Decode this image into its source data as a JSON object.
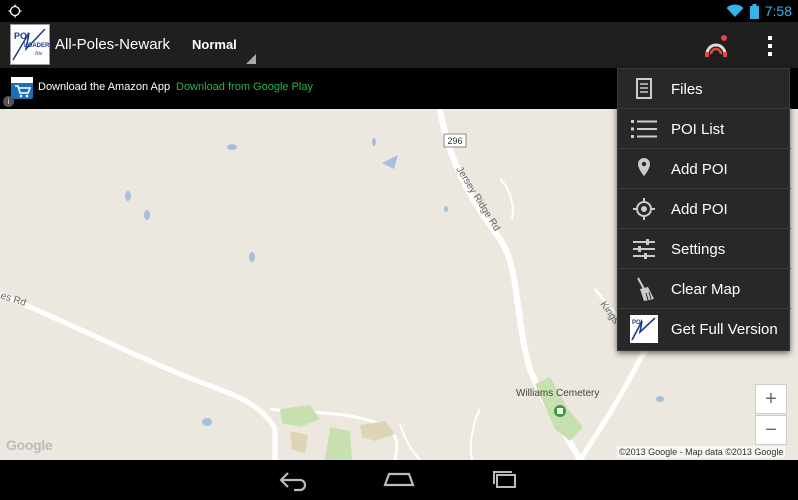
{
  "status_bar": {
    "time": "7:58",
    "icons": [
      "debug-icon",
      "wifi-icon",
      "battery-icon"
    ]
  },
  "action_bar": {
    "app_title": "All-Poles-Newark",
    "mode_value": "Normal",
    "logo_text": "POI LOADER lite",
    "icons": [
      "signal-tracking-icon",
      "overflow-menu-icon"
    ]
  },
  "ad_banner": {
    "text": "Download the Amazon App",
    "link": "Download from Google Play",
    "info": "i"
  },
  "map": {
    "route_shield": "296",
    "road_labels": {
      "jersey_ridge": "Jersey Ridge Rd",
      "es_rd": "es Rd",
      "kings": "Kings"
    },
    "poi_label": "Williams Cemetery",
    "google_logo": "Google",
    "attribution": "©2013 Google - Map data ©2013 Google",
    "zoom_in": "+",
    "zoom_out": "−"
  },
  "overflow_menu": {
    "items": [
      {
        "label": "Files",
        "icon": "file-list-icon"
      },
      {
        "label": "POI List",
        "icon": "poi-list-icon"
      },
      {
        "label": "Add POI",
        "icon": "map-pin-icon"
      },
      {
        "label": "Add POI",
        "icon": "gps-target-icon"
      },
      {
        "label": "Settings",
        "icon": "sliders-icon"
      },
      {
        "label": "Clear Map",
        "icon": "broom-icon"
      },
      {
        "label": "Get Full Version",
        "icon": "app-logo-icon"
      }
    ]
  },
  "nav_bar": {
    "icons": [
      "back-icon",
      "home-icon",
      "recent-apps-icon"
    ]
  },
  "colors": {
    "accent_blue": "#33b5e5",
    "map_background": "#ede8df",
    "menu_background": "#282828",
    "ad_link": "#2bb24c",
    "water": "#a5bfdd",
    "park": "#c8dfb0"
  }
}
